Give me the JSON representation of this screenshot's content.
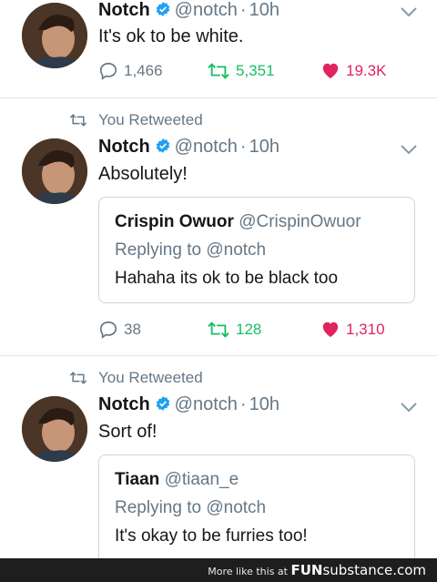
{
  "colors": {
    "verified": "#1da1f2",
    "retweet": "#17bf63",
    "like": "#e0245e",
    "muted": "#657786",
    "text": "#14171a"
  },
  "tweets": [
    {
      "retweet_label": "",
      "author_name": "Notch",
      "author_handle": "@notch",
      "separator": "·",
      "time": "10h",
      "text": "It's ok to be white.",
      "reply_count": "1,466",
      "retweet_count": "5,351",
      "like_count": "19.3K",
      "icons": [
        "avatar",
        "verified-badge-icon",
        "chevron-down-icon",
        "reply-icon",
        "retweet-icon",
        "heart-icon"
      ]
    },
    {
      "retweet_label": "You Retweeted",
      "author_name": "Notch",
      "author_handle": "@notch",
      "separator": "·",
      "time": "10h",
      "text": "Absolutely!",
      "quote": {
        "name": "Crispin Owuor",
        "handle": "@CrispinOwuor",
        "replying_to": "Replying to @notch",
        "text": "Hahaha its ok to be black too"
      },
      "reply_count": "38",
      "retweet_count": "128",
      "like_count": "1,310"
    },
    {
      "retweet_label": "You Retweeted",
      "author_name": "Notch",
      "author_handle": "@notch",
      "separator": "·",
      "time": "10h",
      "text": "Sort of!",
      "quote": {
        "name": "Tiaan",
        "handle": "@tiaan_e",
        "replying_to": "Replying to @notch",
        "text": "It's okay to be furries too!"
      }
    }
  ],
  "footer": {
    "text": "More like this at",
    "brand_bold": "FUN",
    "brand_rest": "substance",
    "domain": ".com"
  }
}
